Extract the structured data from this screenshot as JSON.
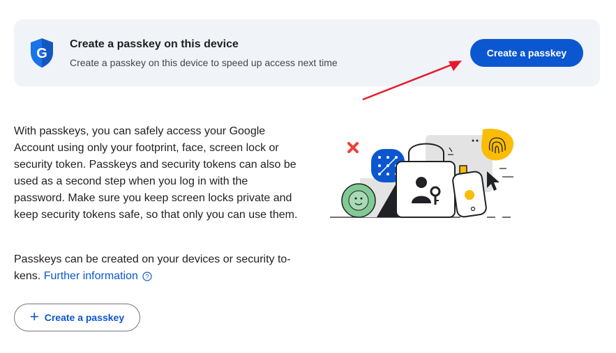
{
  "banner": {
    "title": "Create a passkey on this device",
    "subtitle": "Create a passkey on this device to speed up access next time",
    "button_label": "Create a passkey"
  },
  "body": {
    "paragraph1": "With passkeys, you can safely access your Google Account using only your footprint, face, screen lock or security token. Passkeys and security tokens can also be used as a second step when you log in with the password. Make sure you keep screen locks private and keep security tokens safe, so that only you can use them.",
    "paragraph2_text": "Passkeys can be created on your devices or security to­kens.",
    "further_info_link": "Further information"
  },
  "create_button": {
    "plus": "+",
    "label": "Create a passkey"
  },
  "icons": {
    "shield": "google-shield-icon",
    "help": "help-circle-icon",
    "arrow": "red-annotation-arrow"
  },
  "colors": {
    "primary": "#0b57d0",
    "banner_bg": "#f0f4f9",
    "arrow": "#e8192c"
  }
}
